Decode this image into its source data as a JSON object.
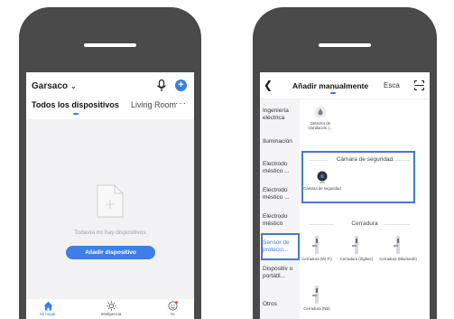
{
  "left_app": {
    "home_name": "Garsaco",
    "tabs": {
      "all": "Todos los dispositivos",
      "room": "Living Room"
    },
    "empty_text": "Todavía no hay dispositivos",
    "add_button": "Añadir dispositivo",
    "nav": {
      "home": "Mi hogar",
      "smart": "Inteligencia",
      "me": "Yo"
    },
    "colors": {
      "accent": "#3b7de9",
      "body_bg": "#f2f2f4"
    }
  },
  "right_app": {
    "header": {
      "title": "Añadir manualmente",
      "scan": "Esca"
    },
    "categories": [
      "Ingeniería eléctrica",
      "Iluminación",
      "Electrodo méstico ...",
      "Electrodo méstico ...",
      "Electrodo méstico",
      "Sensor de protecci...",
      "Dispositiv o portátil...",
      "Otros"
    ],
    "top_device": "Detector de inundación (...",
    "camera_section": {
      "title": "Cámara de seguridad",
      "device": "Cámara de seguridad"
    },
    "lock_section": {
      "title": "Cerradura",
      "devices": [
        "Cerradura (Wi-Fi)",
        "Cerradura (Zigbee)",
        "Cerradura (Bluetooth)",
        "Cerradura (NB)"
      ]
    },
    "colors": {
      "highlight": "#4a78c8",
      "accent": "#3b7de9"
    }
  }
}
